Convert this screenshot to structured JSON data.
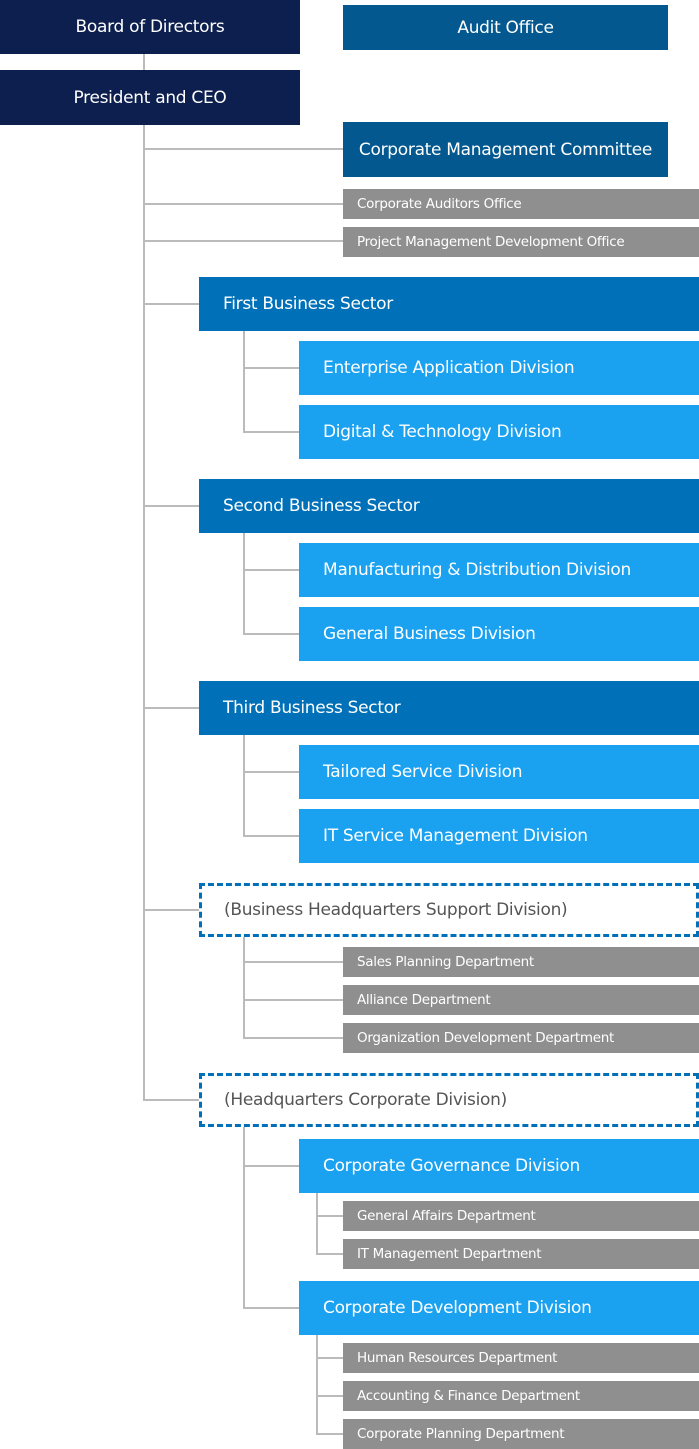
{
  "top": {
    "board": "Board of Directors",
    "audit_office": "Audit Office",
    "president": "President and CEO",
    "corporate_management_committee": "Corporate Management Committee",
    "corporate_auditors_office": "Corporate Auditors Office",
    "project_management_development_office": "Project Management Development Office"
  },
  "sectors": [
    {
      "label": "First Business Sector",
      "divisions": [
        "Enterprise Application Division",
        "Digital & Technology Division"
      ]
    },
    {
      "label": "Second Business Sector",
      "divisions": [
        "Manufacturing & Distribution Division",
        "General Business Division"
      ]
    },
    {
      "label": "Third Business Sector",
      "divisions": [
        "Tailored Service Division",
        "IT Service Management Division"
      ]
    }
  ],
  "support": {
    "label": "(Business Headquarters Support Division)",
    "departments": [
      "Sales Planning Department",
      "Alliance Department",
      "Organization Development Department"
    ]
  },
  "corporate": {
    "label": "(Headquarters Corporate Division)",
    "divisions": [
      {
        "label": "Corporate Governance Division",
        "departments": [
          "General Affairs Department",
          "IT Management Department"
        ]
      },
      {
        "label": "Corporate Development Division",
        "departments": [
          "Human Resources Department",
          "Accounting & Finance Department",
          "Corporate Planning Department"
        ]
      }
    ]
  },
  "colors": {
    "navy": "#0c1f4f",
    "audit": "#03588f",
    "sector": "#0070b8",
    "division": "#1aa1f0",
    "department": "#8f8f8f",
    "connector": "#bbbbbb"
  }
}
